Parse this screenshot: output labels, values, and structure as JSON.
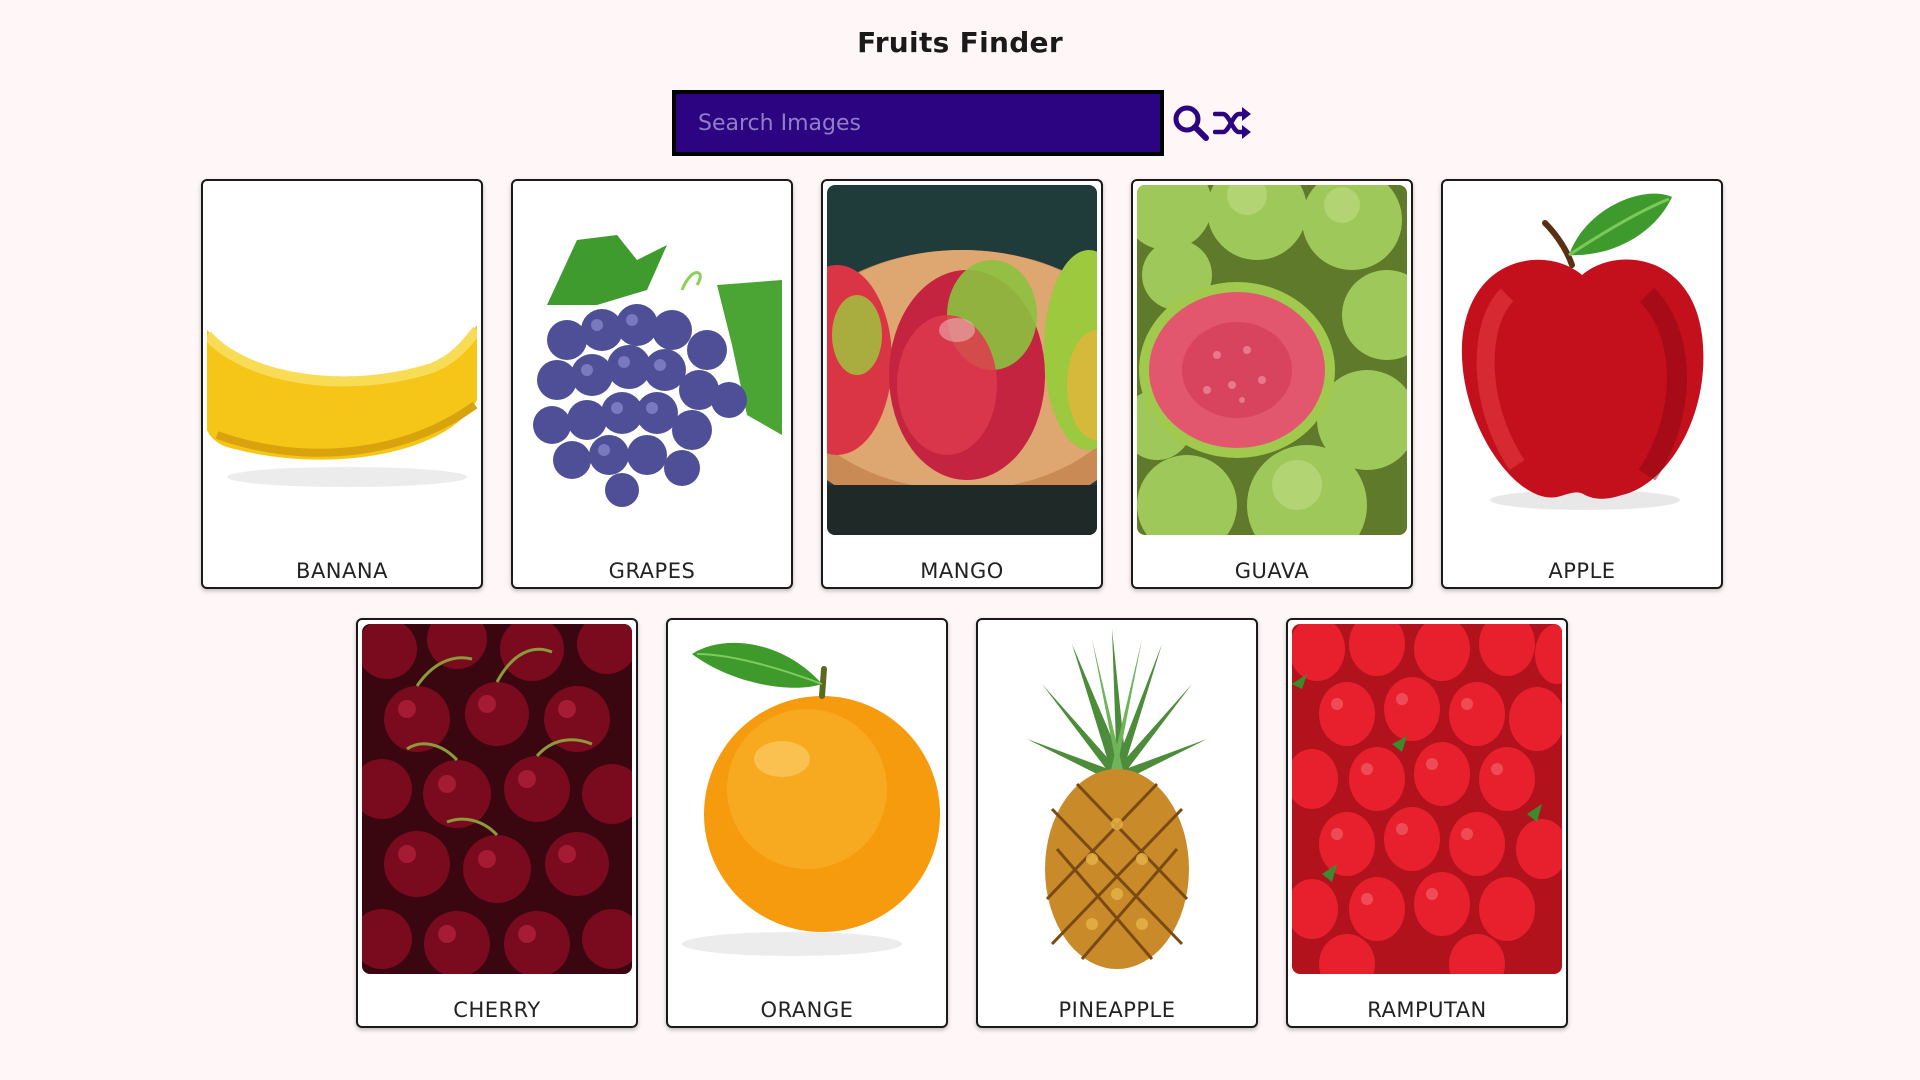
{
  "header": {
    "title": "Fruits Finder"
  },
  "search": {
    "placeholder": "Search Images",
    "value": ""
  },
  "toolbar": {
    "search_icon": "search-icon",
    "shuffle_icon": "shuffle-icon"
  },
  "colors": {
    "accent": "#2c0380",
    "background": "#fff7f7"
  },
  "cards": [
    {
      "label": "BANANA"
    },
    {
      "label": "GRAPES"
    },
    {
      "label": "MANGO"
    },
    {
      "label": "GUAVA"
    },
    {
      "label": "APPLE"
    },
    {
      "label": "CHERRY"
    },
    {
      "label": "ORANGE"
    },
    {
      "label": "PINEAPPLE"
    },
    {
      "label": "RAMPUTAN"
    }
  ]
}
